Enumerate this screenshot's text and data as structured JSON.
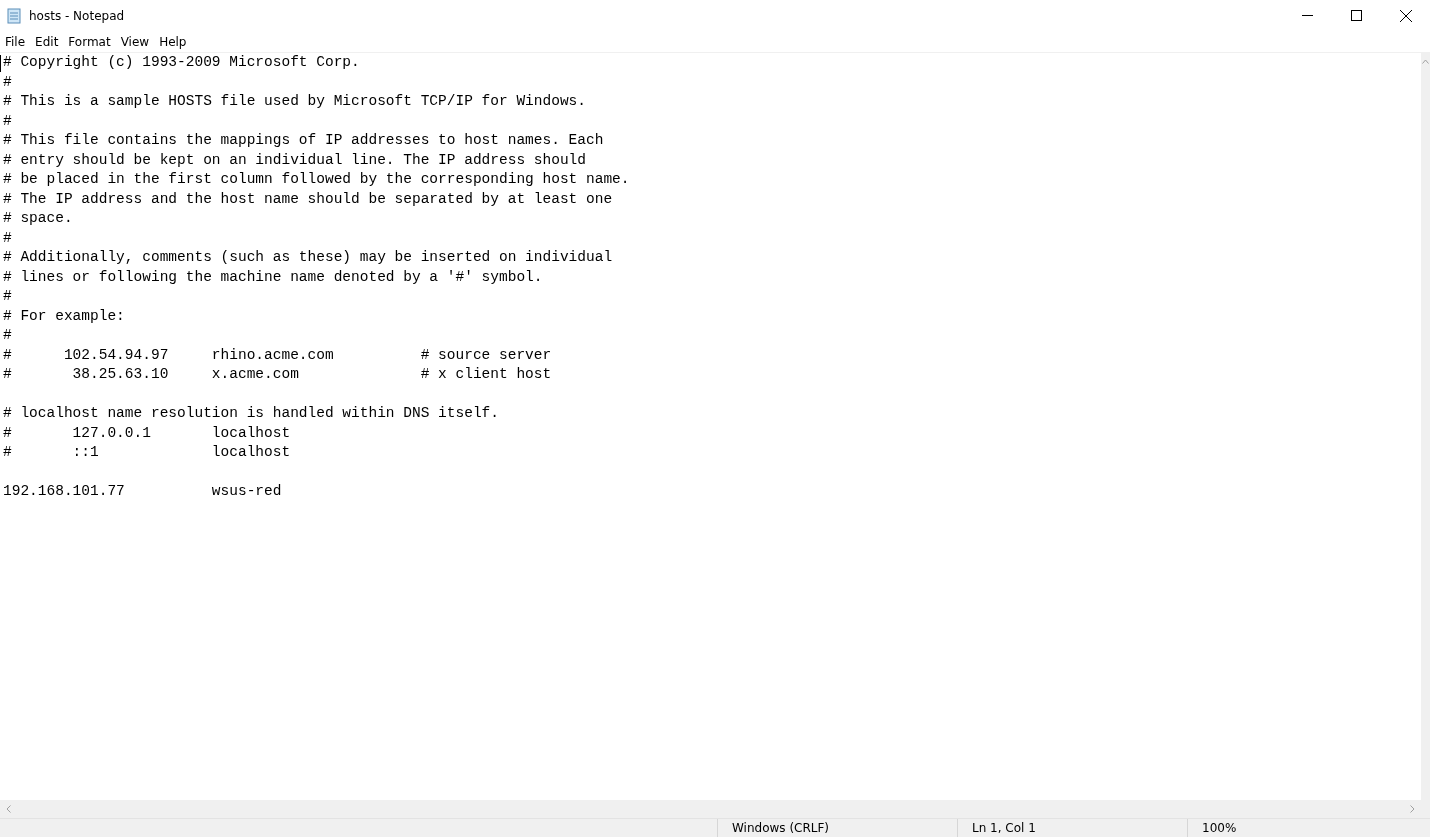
{
  "window": {
    "title": "hosts - Notepad"
  },
  "menu": [
    "File",
    "Edit",
    "Format",
    "View",
    "Help"
  ],
  "editor": {
    "lines": [
      {
        "kind": "text",
        "text": "# Copyright (c) 1993-2009 Microsoft Corp."
      },
      {
        "kind": "text",
        "text": "#"
      },
      {
        "kind": "text",
        "text": "# This is a sample HOSTS file used by Microsoft TCP/IP for Windows."
      },
      {
        "kind": "text",
        "text": "#"
      },
      {
        "kind": "text",
        "text": "# This file contains the mappings of IP addresses to host names. Each"
      },
      {
        "kind": "text",
        "text": "# entry should be kept on an individual line. The IP address should"
      },
      {
        "kind": "text",
        "text": "# be placed in the first column followed by the corresponding host name."
      },
      {
        "kind": "text",
        "text": "# The IP address and the host name should be separated by at least one"
      },
      {
        "kind": "text",
        "text": "# space."
      },
      {
        "kind": "text",
        "text": "#"
      },
      {
        "kind": "text",
        "text": "# Additionally, comments (such as these) may be inserted on individual"
      },
      {
        "kind": "text",
        "text": "# lines or following the machine name denoted by a '#' symbol."
      },
      {
        "kind": "text",
        "text": "#"
      },
      {
        "kind": "text",
        "text": "# For example:"
      },
      {
        "kind": "text",
        "text": "#"
      },
      {
        "kind": "text",
        "text": "#      102.54.94.97     rhino.acme.com          # source server"
      },
      {
        "kind": "text",
        "text": "#       38.25.63.10     x.acme.com              # x client host"
      },
      {
        "kind": "blank"
      },
      {
        "kind": "text",
        "text": "# localhost name resolution is handled within DNS itself."
      },
      {
        "kind": "text",
        "text": "#       127.0.0.1       localhost"
      },
      {
        "kind": "text",
        "text": "#       ::1             localhost"
      },
      {
        "kind": "blank"
      },
      {
        "kind": "text",
        "text": "192.168.101.77          wsus-red"
      }
    ]
  },
  "status_bar": [
    "Windows (CRLF)",
    "Ln 1, Col 1",
    "100%"
  ]
}
